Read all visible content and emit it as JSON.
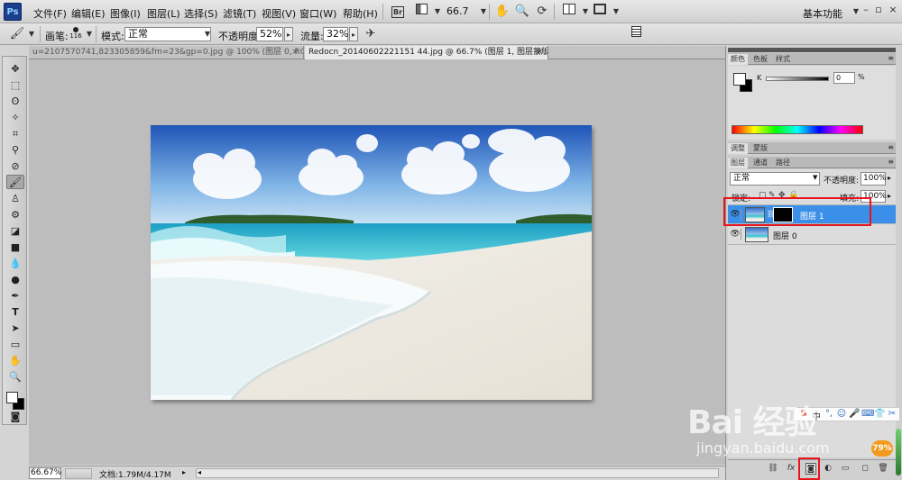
{
  "app": {
    "logo": "Ps"
  },
  "menu": [
    "文件(F)",
    "编辑(E)",
    "图像(I)",
    "图层(L)",
    "选择(S)",
    "滤镜(T)",
    "视图(V)",
    "窗口(W)",
    "帮助(H)"
  ],
  "menubar": {
    "zoom": "66.7",
    "workspace": "基本功能",
    "win_minimize": "–",
    "win_restore": "▫",
    "win_close": "×",
    "icons": [
      "bridge-icon",
      "mini-bridge-icon",
      "hand-tool-icon",
      "zoom-tool-icon",
      "rotate-view-icon",
      "arrange-documents-icon",
      "screen-mode-icon"
    ]
  },
  "options": {
    "brush_label": "画笔:",
    "brush_size": "116",
    "mode_label": "模式:",
    "mode_value": "正常",
    "opacity_label": "不透明度:",
    "opacity_value": "52%",
    "flow_label": "流量:",
    "flow_value": "32%"
  },
  "tabs": [
    {
      "label": "u=2107570741,823305859&fm=23&gp=0.jpg @ 100% (图层 0, RGB/8#) *",
      "close": "×",
      "active": false
    },
    {
      "label": "Redocn_20140602221151 44.jpg @ 66.7% (图层 1, 图层蒙版/8) *",
      "close": "×",
      "active": true
    }
  ],
  "status": {
    "zoom": "66.67%",
    "doc_size": "文档:1.79M/4.17M"
  },
  "color_panel": {
    "tabs": [
      "颜色",
      "色板",
      "样式"
    ],
    "channel": "K",
    "value": "0",
    "unit": "%"
  },
  "adjust_tabs": [
    "调整",
    "蒙版"
  ],
  "layers_panel": {
    "tabs": [
      "图层",
      "通道",
      "路径"
    ],
    "blend_mode": "正常",
    "opacity_label": "不透明度:",
    "opacity_value": "100%",
    "lock_label": "锁定:",
    "fill_label": "填充:",
    "fill_value": "100%",
    "layers": [
      {
        "name": "图层 1",
        "selected": true,
        "has_mask": true
      },
      {
        "name": "图层 0",
        "selected": false,
        "has_mask": false
      }
    ]
  },
  "watermark": {
    "line1": "Bai 经验",
    "line2": "jingyan.baidu.com",
    "badge": "79%"
  },
  "colors": {
    "selection_blue": "#3c8fe8",
    "highlight_red": "#e8141c",
    "ps_blue": "#1b3f8c"
  }
}
